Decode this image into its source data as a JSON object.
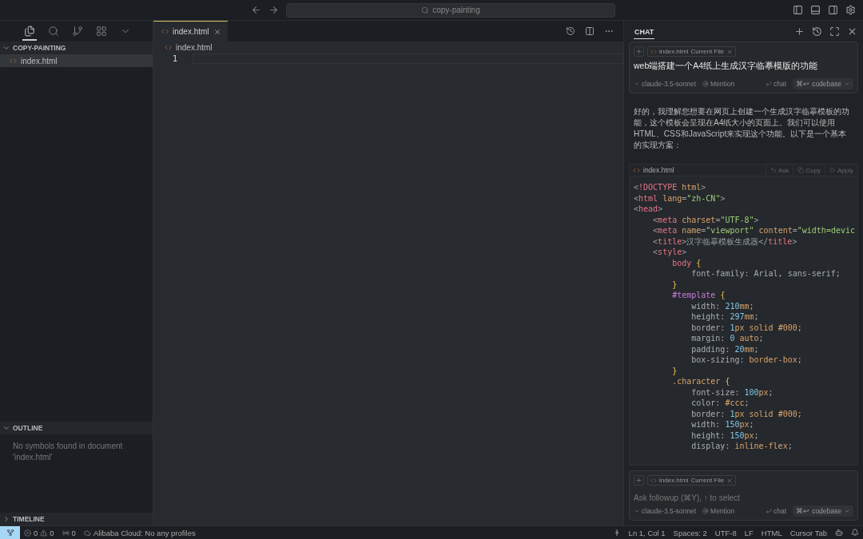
{
  "title_bar": {
    "search": "copy-painting"
  },
  "sidebar": {
    "views": [
      {
        "kind": "files",
        "selected": true
      },
      {
        "kind": "search",
        "selected": false
      },
      {
        "kind": "branch",
        "selected": false
      },
      {
        "kind": "extensions",
        "selected": false
      },
      {
        "kind": "more",
        "selected": false
      }
    ],
    "explorer": {
      "title": "COPY-PAINTING",
      "expanded": true,
      "files": [
        {
          "name": "index.html",
          "selected": true
        }
      ]
    },
    "outline": {
      "title": "OUTLINE",
      "expanded": true,
      "message": "No symbols found in document 'index.html'"
    },
    "timeline": {
      "title": "TIMELINE",
      "expanded": false
    }
  },
  "editor": {
    "tabs": [
      {
        "label": "index.html",
        "selected": true
      }
    ],
    "breadcrumb": "index.html",
    "line_numbers": [
      "1"
    ]
  },
  "chat": {
    "tab": "CHAT",
    "input": {
      "file_chip": "index.html",
      "chip_note": "Current File",
      "text": "web端搭建一个A4纸上生成汉字临摹模版的功能",
      "model": "claude-3.5-sonnet",
      "mention": "Mention",
      "chat": "chat",
      "codebase_key": "⌘↩",
      "codebase": "codebase"
    },
    "reply": "好的，我理解您想要在网页上创建一个生成汉字临摹模板的功能，这个模板会呈现在A4纸大小的页面上。我们可以使用HTML、CSS和JavaScript来实现这个功能。以下是一个基本的实现方案：",
    "code_block": {
      "file": "index.html",
      "actions": [
        {
          "kind": "ask",
          "label": "Ask"
        },
        {
          "kind": "copy",
          "label": "Copy"
        },
        {
          "kind": "apply",
          "label": "Apply"
        }
      ],
      "lines": [
        [
          {
            "t": "<",
            "kind": "p"
          },
          {
            "t": "!DOCTYPE",
            "kind": "tag"
          },
          {
            "t": " html",
            "kind": "attr"
          },
          {
            "t": ">",
            "kind": "p"
          }
        ],
        [
          {
            "t": "<",
            "kind": "p"
          },
          {
            "t": "html",
            "kind": "tag"
          },
          {
            "t": " lang",
            "kind": "attr"
          },
          {
            "t": "=",
            "kind": "p"
          },
          {
            "t": "\"zh-CN\"",
            "kind": "str"
          },
          {
            "t": ">",
            "kind": "p"
          }
        ],
        [
          {
            "t": "<",
            "kind": "p"
          },
          {
            "t": "head",
            "kind": "tag"
          },
          {
            "t": ">",
            "kind": "p"
          }
        ],
        [
          {
            "t": "    <",
            "kind": "p"
          },
          {
            "t": "meta",
            "kind": "tag"
          },
          {
            "t": " charset",
            "kind": "attr"
          },
          {
            "t": "=",
            "kind": "p"
          },
          {
            "t": "\"UTF-8\"",
            "kind": "str"
          },
          {
            "t": ">",
            "kind": "p"
          }
        ],
        [
          {
            "t": "    <",
            "kind": "p"
          },
          {
            "t": "meta",
            "kind": "tag"
          },
          {
            "t": " name",
            "kind": "attr"
          },
          {
            "t": "=",
            "kind": "p"
          },
          {
            "t": "\"viewport\"",
            "kind": "str"
          },
          {
            "t": " content",
            "kind": "attr"
          },
          {
            "t": "=",
            "kind": "p"
          },
          {
            "t": "\"width=devic",
            "kind": "str"
          }
        ],
        [
          {
            "t": "    <",
            "kind": "p"
          },
          {
            "t": "title",
            "kind": "tag"
          },
          {
            "t": ">汉字临摹模板生成器</",
            "kind": "p"
          },
          {
            "t": "title",
            "kind": "tag"
          },
          {
            "t": ">",
            "kind": "p"
          }
        ],
        [
          {
            "t": "    <",
            "kind": "p"
          },
          {
            "t": "style",
            "kind": "tag"
          },
          {
            "t": ">",
            "kind": "p"
          }
        ],
        [
          {
            "t": "        body",
            "kind": "tag"
          },
          {
            "t": " {",
            "kind": "brace"
          }
        ],
        [
          {
            "t": "            font-family: Arial, sans-serif;",
            "kind": "prop"
          }
        ],
        [
          {
            "t": "        }",
            "kind": "brace"
          }
        ],
        [
          {
            "t": "        #template",
            "kind": "id"
          },
          {
            "t": " {",
            "kind": "brace"
          }
        ],
        [
          {
            "t": "            width: ",
            "kind": "prop"
          },
          {
            "t": "210",
            "kind": "num"
          },
          {
            "t": "mm",
            "kind": "unit"
          },
          {
            "t": ";",
            "kind": "prop"
          }
        ],
        [
          {
            "t": "            height: ",
            "kind": "prop"
          },
          {
            "t": "297",
            "kind": "num"
          },
          {
            "t": "mm",
            "kind": "unit"
          },
          {
            "t": ";",
            "kind": "prop"
          }
        ],
        [
          {
            "t": "            border: ",
            "kind": "prop"
          },
          {
            "t": "1",
            "kind": "num"
          },
          {
            "t": "px solid #000",
            "kind": "unit"
          },
          {
            "t": ";",
            "kind": "prop"
          }
        ],
        [
          {
            "t": "            margin: ",
            "kind": "prop"
          },
          {
            "t": "0",
            "kind": "num"
          },
          {
            "t": " auto",
            "kind": "unit"
          },
          {
            "t": ";",
            "kind": "prop"
          }
        ],
        [
          {
            "t": "            padding: ",
            "kind": "prop"
          },
          {
            "t": "20",
            "kind": "num"
          },
          {
            "t": "mm",
            "kind": "unit"
          },
          {
            "t": ";",
            "kind": "prop"
          }
        ],
        [
          {
            "t": "            box-sizing: ",
            "kind": "prop"
          },
          {
            "t": "border-box",
            "kind": "unit"
          },
          {
            "t": ";",
            "kind": "prop"
          }
        ],
        [
          {
            "t": "        }",
            "kind": "brace"
          }
        ],
        [
          {
            "t": "        .character",
            "kind": "cls"
          },
          {
            "t": " {",
            "kind": "brace"
          }
        ],
        [
          {
            "t": "            font-size: ",
            "kind": "prop"
          },
          {
            "t": "100",
            "kind": "num"
          },
          {
            "t": "px",
            "kind": "unit"
          },
          {
            "t": ";",
            "kind": "prop"
          }
        ],
        [
          {
            "t": "            color: ",
            "kind": "prop"
          },
          {
            "t": "#ccc",
            "kind": "unit"
          },
          {
            "t": ";",
            "kind": "prop"
          }
        ],
        [
          {
            "t": "            border: ",
            "kind": "prop"
          },
          {
            "t": "1",
            "kind": "num"
          },
          {
            "t": "px solid #000",
            "kind": "unit"
          },
          {
            "t": ";",
            "kind": "prop"
          }
        ],
        [
          {
            "t": "            width: ",
            "kind": "prop"
          },
          {
            "t": "150",
            "kind": "num"
          },
          {
            "t": "px",
            "kind": "unit"
          },
          {
            "t": ";",
            "kind": "prop"
          }
        ],
        [
          {
            "t": "            height: ",
            "kind": "prop"
          },
          {
            "t": "150",
            "kind": "num"
          },
          {
            "t": "px",
            "kind": "unit"
          },
          {
            "t": ";",
            "kind": "prop"
          }
        ],
        [
          {
            "t": "            display: ",
            "kind": "prop"
          },
          {
            "t": "inline-flex",
            "kind": "unit"
          },
          {
            "t": ";",
            "kind": "prop"
          }
        ]
      ]
    },
    "followup": {
      "file_chip": "index.html",
      "chip_note": "Current File",
      "placeholder": "Ask followup (⌘Y), ↑ to select",
      "model": "claude-3.5-sonnet",
      "mention": "Mention",
      "chat": "chat",
      "codebase_key": "⌘↩",
      "codebase": "codebase"
    }
  },
  "status_bar": {
    "errors": "0",
    "warnings": "0",
    "ports": "0",
    "cloud": "Alibaba Cloud: No any profiles",
    "position": "Ln 1, Col 1",
    "spaces": "Spaces: 2",
    "encoding": "UTF-8",
    "eol": "LF",
    "language": "HTML",
    "cursor_tab": "Cursor Tab"
  }
}
